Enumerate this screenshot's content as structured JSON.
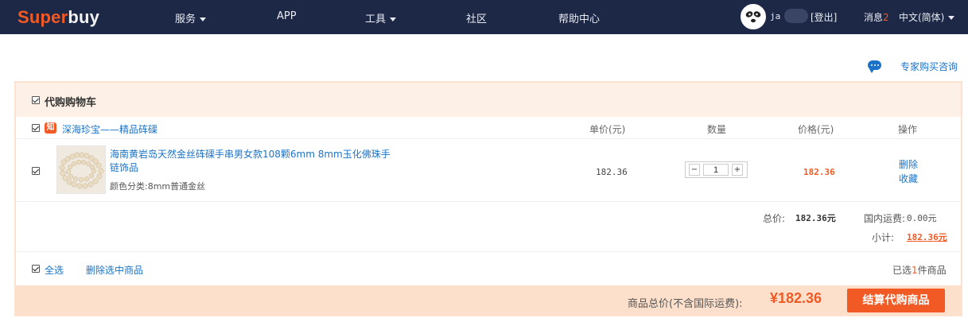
{
  "nav": {
    "logo_part1": "Super",
    "logo_part2": "buy",
    "items": [
      {
        "label": "服务",
        "has_caret": true
      },
      {
        "label": "APP",
        "has_caret": false
      },
      {
        "label": "工具",
        "has_caret": true
      },
      {
        "label": "社区",
        "has_caret": false
      },
      {
        "label": "帮助中心",
        "has_caret": false
      }
    ],
    "user_name": "ja",
    "logout_label": "[登出]",
    "messages_label": "消息",
    "messages_count": "2",
    "language_label": "中文(简体)"
  },
  "expert": {
    "icon": "chat-bubble-icon",
    "label": "专家购买咨询"
  },
  "cart": {
    "title": "代购购物车",
    "shop": {
      "icon_text": "知",
      "name": "深海珍宝——精品砗磲"
    },
    "columns": {
      "unit_price": "单价(元)",
      "quantity": "数量",
      "price": "价格(元)",
      "actions": "操作"
    },
    "items": [
      {
        "title": "海南黄岩岛天然金丝砗磲手串男女款108颗6mm 8mm玉化佛珠手链饰品",
        "spec": "颜色分类:8mm普通金丝",
        "unit_price": "182.36",
        "quantity": "1",
        "price": "182.36",
        "delete_label": "删除",
        "favorite_label": "收藏"
      }
    ],
    "summary": {
      "total_label": "总价:",
      "total_value": "182.36元",
      "shipping_label": "国内运费:",
      "shipping_value": "0.00元",
      "subtotal_label": "小计:",
      "subtotal_value": "182.36元"
    },
    "select_all_label": "全选",
    "delete_selected_label": "删除选中商品",
    "selected_prefix": "已选",
    "selected_count": "1",
    "selected_suffix": "件商品",
    "footer": {
      "total_label": "商品总价(不含国际运费):",
      "total_value": "¥182.36",
      "checkout_label": "结算代购商品"
    }
  },
  "colors": {
    "nav_bg": "#1c2846",
    "accent": "#f15a24",
    "link": "#1a73c8",
    "cart_header_bg": "#fdf0e7",
    "footer_bg": "#fde0cc"
  }
}
